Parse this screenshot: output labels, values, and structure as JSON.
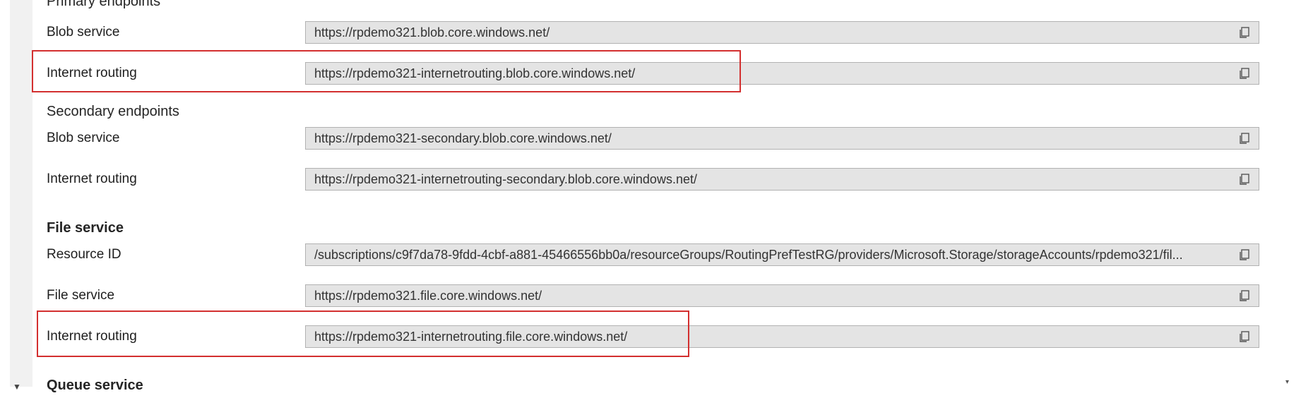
{
  "sections": {
    "primary_heading": "Primary endpoints",
    "secondary_heading": "Secondary endpoints",
    "file_service_heading": "File service",
    "queue_service_heading": "Queue service"
  },
  "rows": [
    {
      "label": "Blob service",
      "value": "https://rpdemo321.blob.core.windows.net/"
    },
    {
      "label": "Internet routing",
      "value": "https://rpdemo321-internetrouting.blob.core.windows.net/"
    },
    {
      "label": "Blob service",
      "value": "https://rpdemo321-secondary.blob.core.windows.net/"
    },
    {
      "label": "Internet routing",
      "value": "https://rpdemo321-internetrouting-secondary.blob.core.windows.net/"
    },
    {
      "label": "Resource ID",
      "value": "/subscriptions/c9f7da78-9fdd-4cbf-a881-45466556bb0a/resourceGroups/RoutingPrefTestRG/providers/Microsoft.Storage/storageAccounts/rpdemo321/fil..."
    },
    {
      "label": "File service",
      "value": "https://rpdemo321.file.core.windows.net/"
    },
    {
      "label": "Internet routing",
      "value": "https://rpdemo321-internetrouting.file.core.windows.net/"
    }
  ],
  "icons": {
    "copy": "copy-icon",
    "scroll_down": "chevron-down-icon"
  },
  "colors": {
    "highlight": "#d32f2f",
    "field_bg": "#e4e4e4"
  }
}
